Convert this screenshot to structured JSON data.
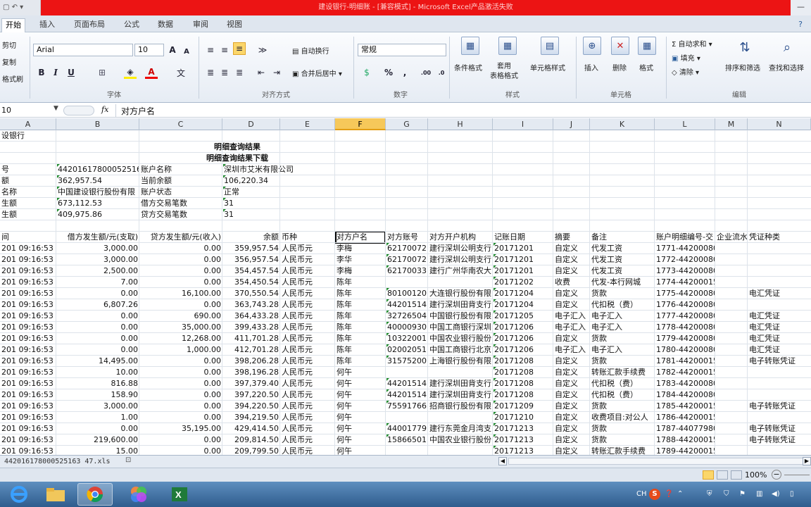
{
  "window": {
    "title": "建设银行-明细账 - [兼容模式] - Microsoft Excel产品激活失败",
    "qat_label": "▢ ↶ ▾"
  },
  "ribbon_tabs": [
    "开始",
    "插入",
    "页面布局",
    "公式",
    "数据",
    "审阅",
    "视图"
  ],
  "ribbon": {
    "clipboard": {
      "cut": "剪切",
      "copy": "复制",
      "format_painter": "格式刷"
    },
    "font": {
      "name": "Arial",
      "size": "10",
      "bold": "B",
      "italic": "I",
      "underline": "U",
      "label": "字体"
    },
    "alignment": {
      "wrap": "自动换行",
      "merge": "合并后居中",
      "label": "对齐方式"
    },
    "number": {
      "format": "常规",
      "percent": "%",
      "comma": ",",
      "label": "数字"
    },
    "styles": {
      "conditional": "条件格式",
      "table": "套用\n表格格式",
      "cell": "单元格样式",
      "label": "样式"
    },
    "cells": {
      "insert": "插入",
      "delete": "删除",
      "format": "格式",
      "label": "单元格"
    },
    "editing": {
      "autosum": "自动求和",
      "fill": "填充",
      "clear": "清除",
      "sort": "排序和筛选",
      "find": "查找和选择",
      "label": "编辑"
    }
  },
  "formula_bar": {
    "name_box": "10",
    "fx": "fx",
    "content": "对方户名"
  },
  "colors": {
    "title_red": "#ec1414",
    "selected_col": "#f6c85a",
    "taskbar": "#2f5c8d"
  },
  "columns": [
    "A",
    "B",
    "C",
    "D",
    "E",
    "F",
    "G",
    "H",
    "I",
    "J",
    "K",
    "L",
    "M",
    "N"
  ],
  "header_block": {
    "row1": "设银行",
    "title1": "明细查询结果",
    "title2": "明细查询结果下载",
    "info": [
      {
        "a": "号",
        "b": "44201617800052516",
        "c": "账户名称",
        "d": "深圳市艾米有限公司"
      },
      {
        "a": "额",
        "b": "362,957.54",
        "c": "当前余额",
        "d": "106,220.34"
      },
      {
        "a": "名称",
        "b": "中国建设银行股份有限",
        "c": "账户状态",
        "d": "正常"
      },
      {
        "a": "生额",
        "b": "673,112.53",
        "c": "借方交易笔数",
        "d": "31"
      },
      {
        "a": "生额",
        "b": "409,975.86",
        "c": "贷方交易笔数",
        "d": "31"
      }
    ]
  },
  "table_headers": [
    "间",
    "借方发生额/元(支取)",
    "贷方发生额/元(收入)",
    "余额",
    "币种",
    "对方户名",
    "对方账号",
    "对方开户机构",
    "记账日期",
    "摘要",
    "备注",
    "账户明细编号-交",
    "企业流水",
    "凭证种类"
  ],
  "rows": [
    [
      "201 09:16:53",
      "3,000.00",
      "0.00",
      "359,957.54",
      "人民币元",
      "李梅",
      "62170072",
      "建行深圳公明支行",
      "20171201",
      "自定义",
      "代发工资",
      "1771-44200080",
      "",
      ""
    ],
    [
      "201 09:16:53",
      "3,000.00",
      "0.00",
      "356,957.54",
      "人民币元",
      "李华",
      "62170072",
      "建行深圳公明支行",
      "20171201",
      "自定义",
      "代发工资",
      "1772-44200080",
      "",
      ""
    ],
    [
      "201 09:16:53",
      "2,500.00",
      "0.00",
      "354,457.54",
      "人民币元",
      "李梅",
      "62170033",
      "建行广州华南农大",
      "20171201",
      "自定义",
      "代发工资",
      "1773-44200080",
      "",
      ""
    ],
    [
      "201 09:16:53",
      "7.00",
      "0.00",
      "354,450.54",
      "人民币元",
      "陈年",
      "",
      "",
      "20171202",
      "收费",
      "代发-本行网城",
      "1774-44200015",
      "",
      ""
    ],
    [
      "201 09:16:53",
      "0.00",
      "16,100.00",
      "370,550.54",
      "人民币元",
      "陈年",
      "80100120",
      "大连银行股份有限",
      "20171204",
      "自定义",
      "货款",
      "1775-44200080",
      "",
      "电汇凭证"
    ],
    [
      "201 09:16:53",
      "6,807.26",
      "0.00",
      "363,743.28",
      "人民币元",
      "陈年",
      "44201514",
      "建行深圳田背支行",
      "20171204",
      "自定义",
      "代扣税（费）",
      "1776-44200080",
      "",
      ""
    ],
    [
      "201 09:16:53",
      "0.00",
      "690.00",
      "364,433.28",
      "人民币元",
      "陈年",
      "32726504",
      "中国银行股份有限",
      "20171205",
      "电子汇入",
      "电子汇入",
      "1777-44200080",
      "",
      "电汇凭证"
    ],
    [
      "201 09:16:53",
      "0.00",
      "35,000.00",
      "399,433.28",
      "人民币元",
      "陈年",
      "40000930",
      "中国工商银行深圳",
      "20171206",
      "电子汇入",
      "电子汇入",
      "1778-44200080",
      "",
      "电汇凭证"
    ],
    [
      "201 09:16:53",
      "0.00",
      "12,268.00",
      "411,701.28",
      "人民币元",
      "陈年",
      "10322001",
      "中国农业银行股份",
      "20171206",
      "自定义",
      "货款",
      "1779-44200080",
      "",
      "电汇凭证"
    ],
    [
      "201 09:16:53",
      "0.00",
      "1,000.00",
      "412,701.28",
      "人民币元",
      "陈年",
      "02002051",
      "中国工商银行北京",
      "20171206",
      "电子汇入",
      "电子汇入",
      "1780-44200080",
      "",
      "电汇凭证"
    ],
    [
      "201 09:16:53",
      "14,495.00",
      "0.00",
      "398,206.28",
      "人民币元",
      "陈年",
      "31575200",
      "上海银行股份有限",
      "20171208",
      "自定义",
      "货款",
      "1781-44200015",
      "",
      "电子转账凭证"
    ],
    [
      "201 09:16:53",
      "10.00",
      "0.00",
      "398,196.28",
      "人民币元",
      "何午",
      "",
      "",
      "20171208",
      "自定义",
      "转账汇款手续费",
      "1782-44200015",
      "",
      ""
    ],
    [
      "201 09:16:53",
      "816.88",
      "0.00",
      "397,379.40",
      "人民币元",
      "何午",
      "44201514",
      "建行深圳田背支行",
      "20171208",
      "自定义",
      "代扣税（费）",
      "1783-44200080",
      "",
      ""
    ],
    [
      "201 09:16:53",
      "158.90",
      "0.00",
      "397,220.50",
      "人民币元",
      "何午",
      "44201514",
      "建行深圳田背支行",
      "20171208",
      "自定义",
      "代扣税（费）",
      "1784-44200080",
      "",
      ""
    ],
    [
      "201 09:16:53",
      "3,000.00",
      "0.00",
      "394,220.50",
      "人民币元",
      "何午",
      "75591766",
      "招商银行股份有限",
      "20171209",
      "自定义",
      "货款",
      "1785-44200015",
      "",
      "电子转账凭证"
    ],
    [
      "201 09:16:53",
      "1.00",
      "0.00",
      "394,219.50",
      "人民币元",
      "何午",
      "",
      "",
      "20171210",
      "自定义",
      "收费项目:对公人",
      "1786-44200015",
      "",
      ""
    ],
    [
      "201 09:16:53",
      "0.00",
      "35,195.00",
      "429,414.50",
      "人民币元",
      "何午",
      "44001779",
      "建行东莞金月湾支",
      "20171213",
      "自定义",
      "货款",
      "1787-44077980",
      "",
      "电子转账凭证"
    ],
    [
      "201 09:16:53",
      "219,600.00",
      "0.00",
      "209,814.50",
      "人民币元",
      "何午",
      "15866501",
      "中国农业银行股份",
      "20171213",
      "自定义",
      "货款",
      "1788-44200015",
      "",
      "电子转账凭证"
    ],
    [
      "201 09:16:53",
      "15.00",
      "0.00",
      "209,799.50",
      "人民币元",
      "何午",
      "",
      "",
      "20171213",
      "自定义",
      "转账汇款手续费",
      "1789-44200015",
      "",
      ""
    ]
  ],
  "sheet_tab": "442016178000525163 47.xls",
  "status": {
    "zoom": "100%"
  },
  "tray": {
    "lang": "CH",
    "sogou": "S"
  }
}
